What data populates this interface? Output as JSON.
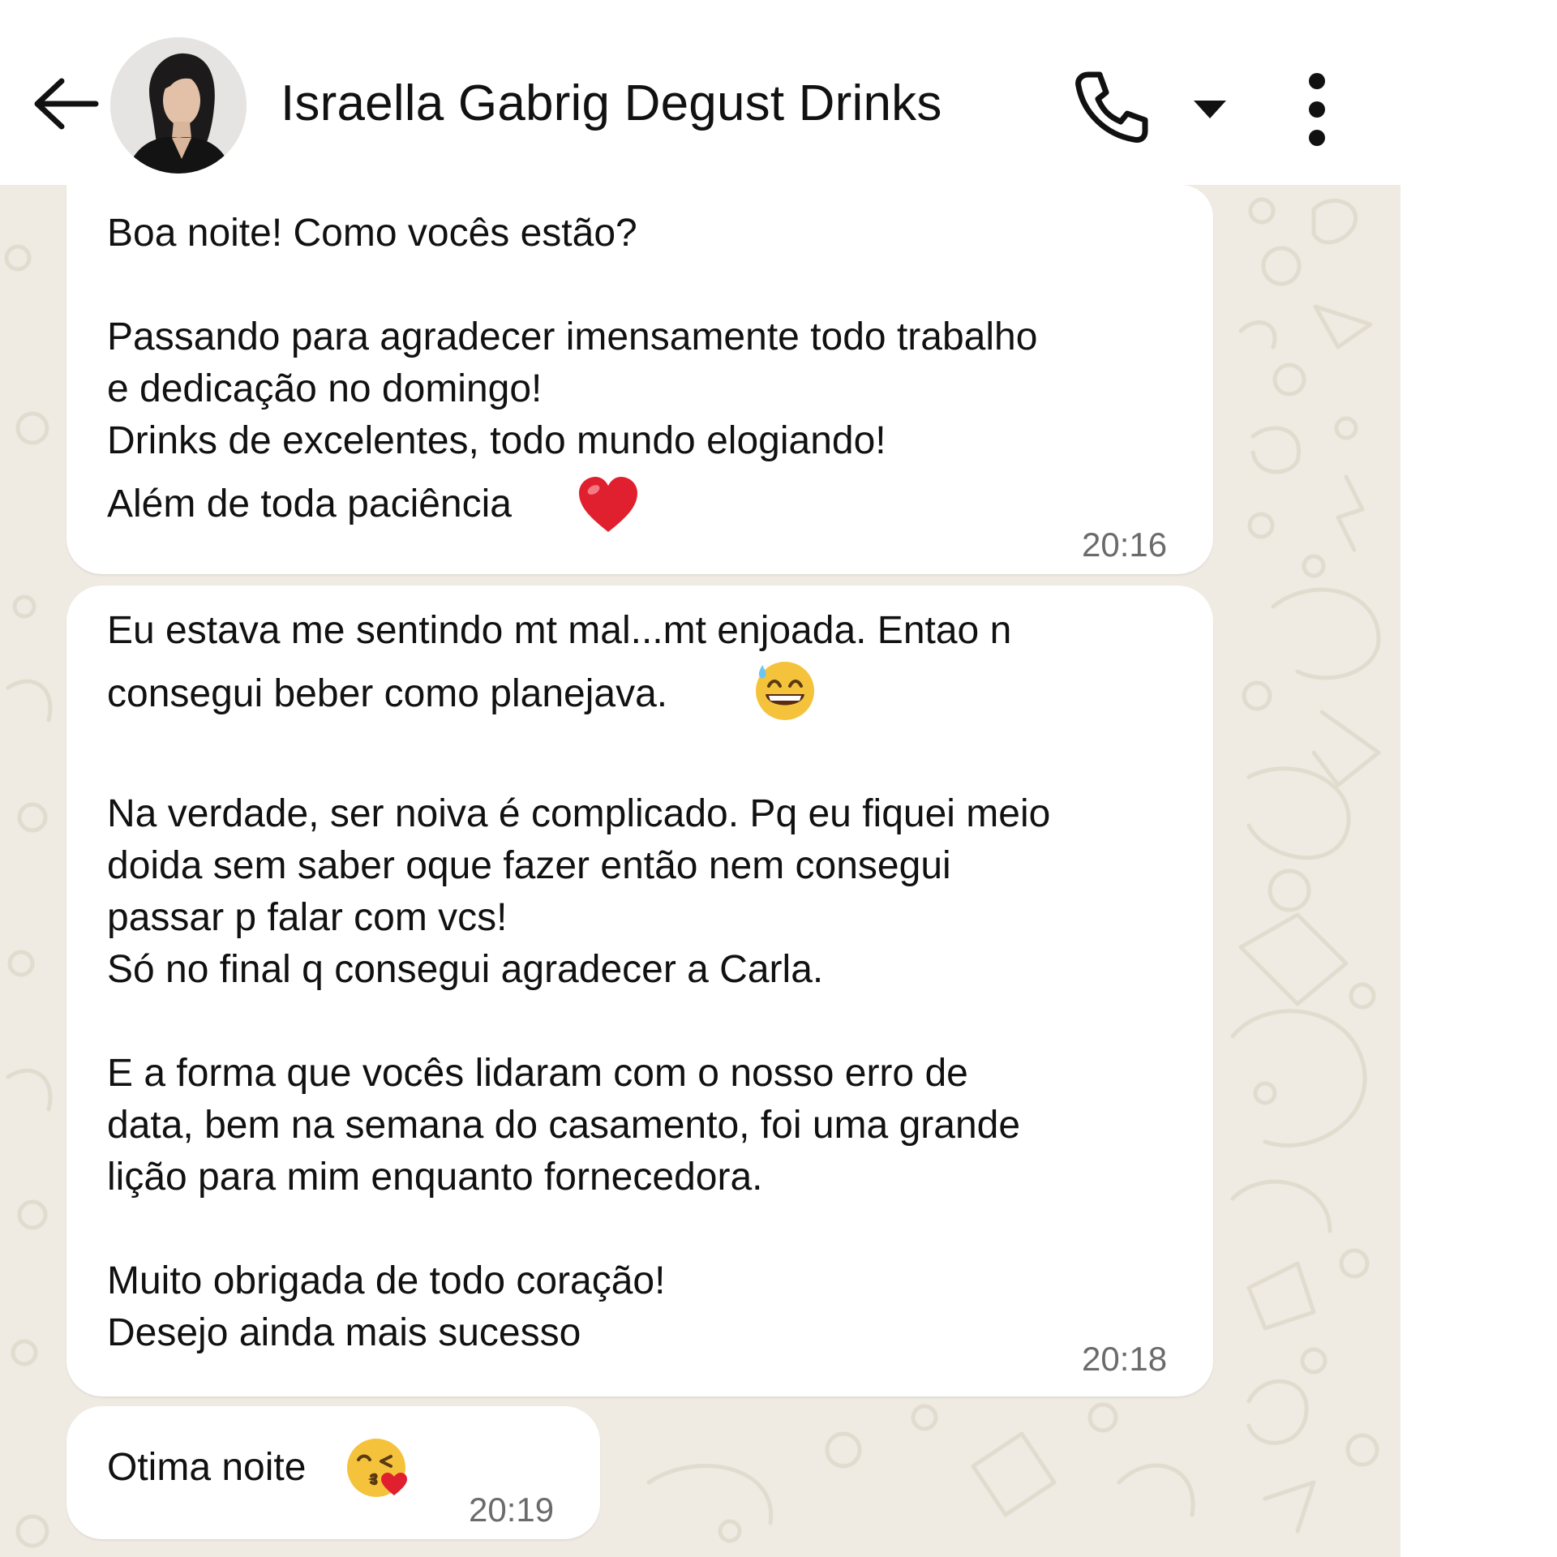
{
  "header": {
    "contact_name": "Israella Gabrig Degust Drinks",
    "icons": [
      "back-arrow-icon",
      "phone-icon",
      "caret-down-icon",
      "more-vert-icon"
    ],
    "colors": {
      "header_bg": "#ffffff",
      "chat_bg": "#efeae2",
      "bubble_bg": "#ffffff"
    }
  },
  "messages": [
    {
      "lines": [
        "Boa noite! Como vocês estão?",
        "Passando para agradecer imensamente todo trabalho",
        "e dedicação no domingo!",
        "Drinks de excelentes, todo mundo elogiando!",
        "Além de toda paciência"
      ],
      "emoji": "red-heart-icon",
      "time": "20:16"
    },
    {
      "lines": [
        "Eu estava me sentindo mt mal...mt enjoada. Entao n",
        "consegui beber como planejava.",
        "Na verdade, ser noiva é complicado. Pq eu fiquei meio",
        "doida sem saber oque  fazer então nem consegui",
        "passar p falar com vcs!",
        "Só no final q consegui agradecer a Carla.",
        "E a forma que vocês lidaram com o nosso erro de",
        "data, bem na semana do casamento, foi uma grande",
        "lição para mim enquanto fornecedora.",
        "Muito obrigada de todo coração!",
        "Desejo ainda mais sucesso"
      ],
      "emoji": "grinning-sweat-face-icon",
      "time": "20:18"
    },
    {
      "lines": [
        "Otima noite"
      ],
      "emoji": "face-blowing-kiss-icon",
      "time": "20:19"
    }
  ]
}
